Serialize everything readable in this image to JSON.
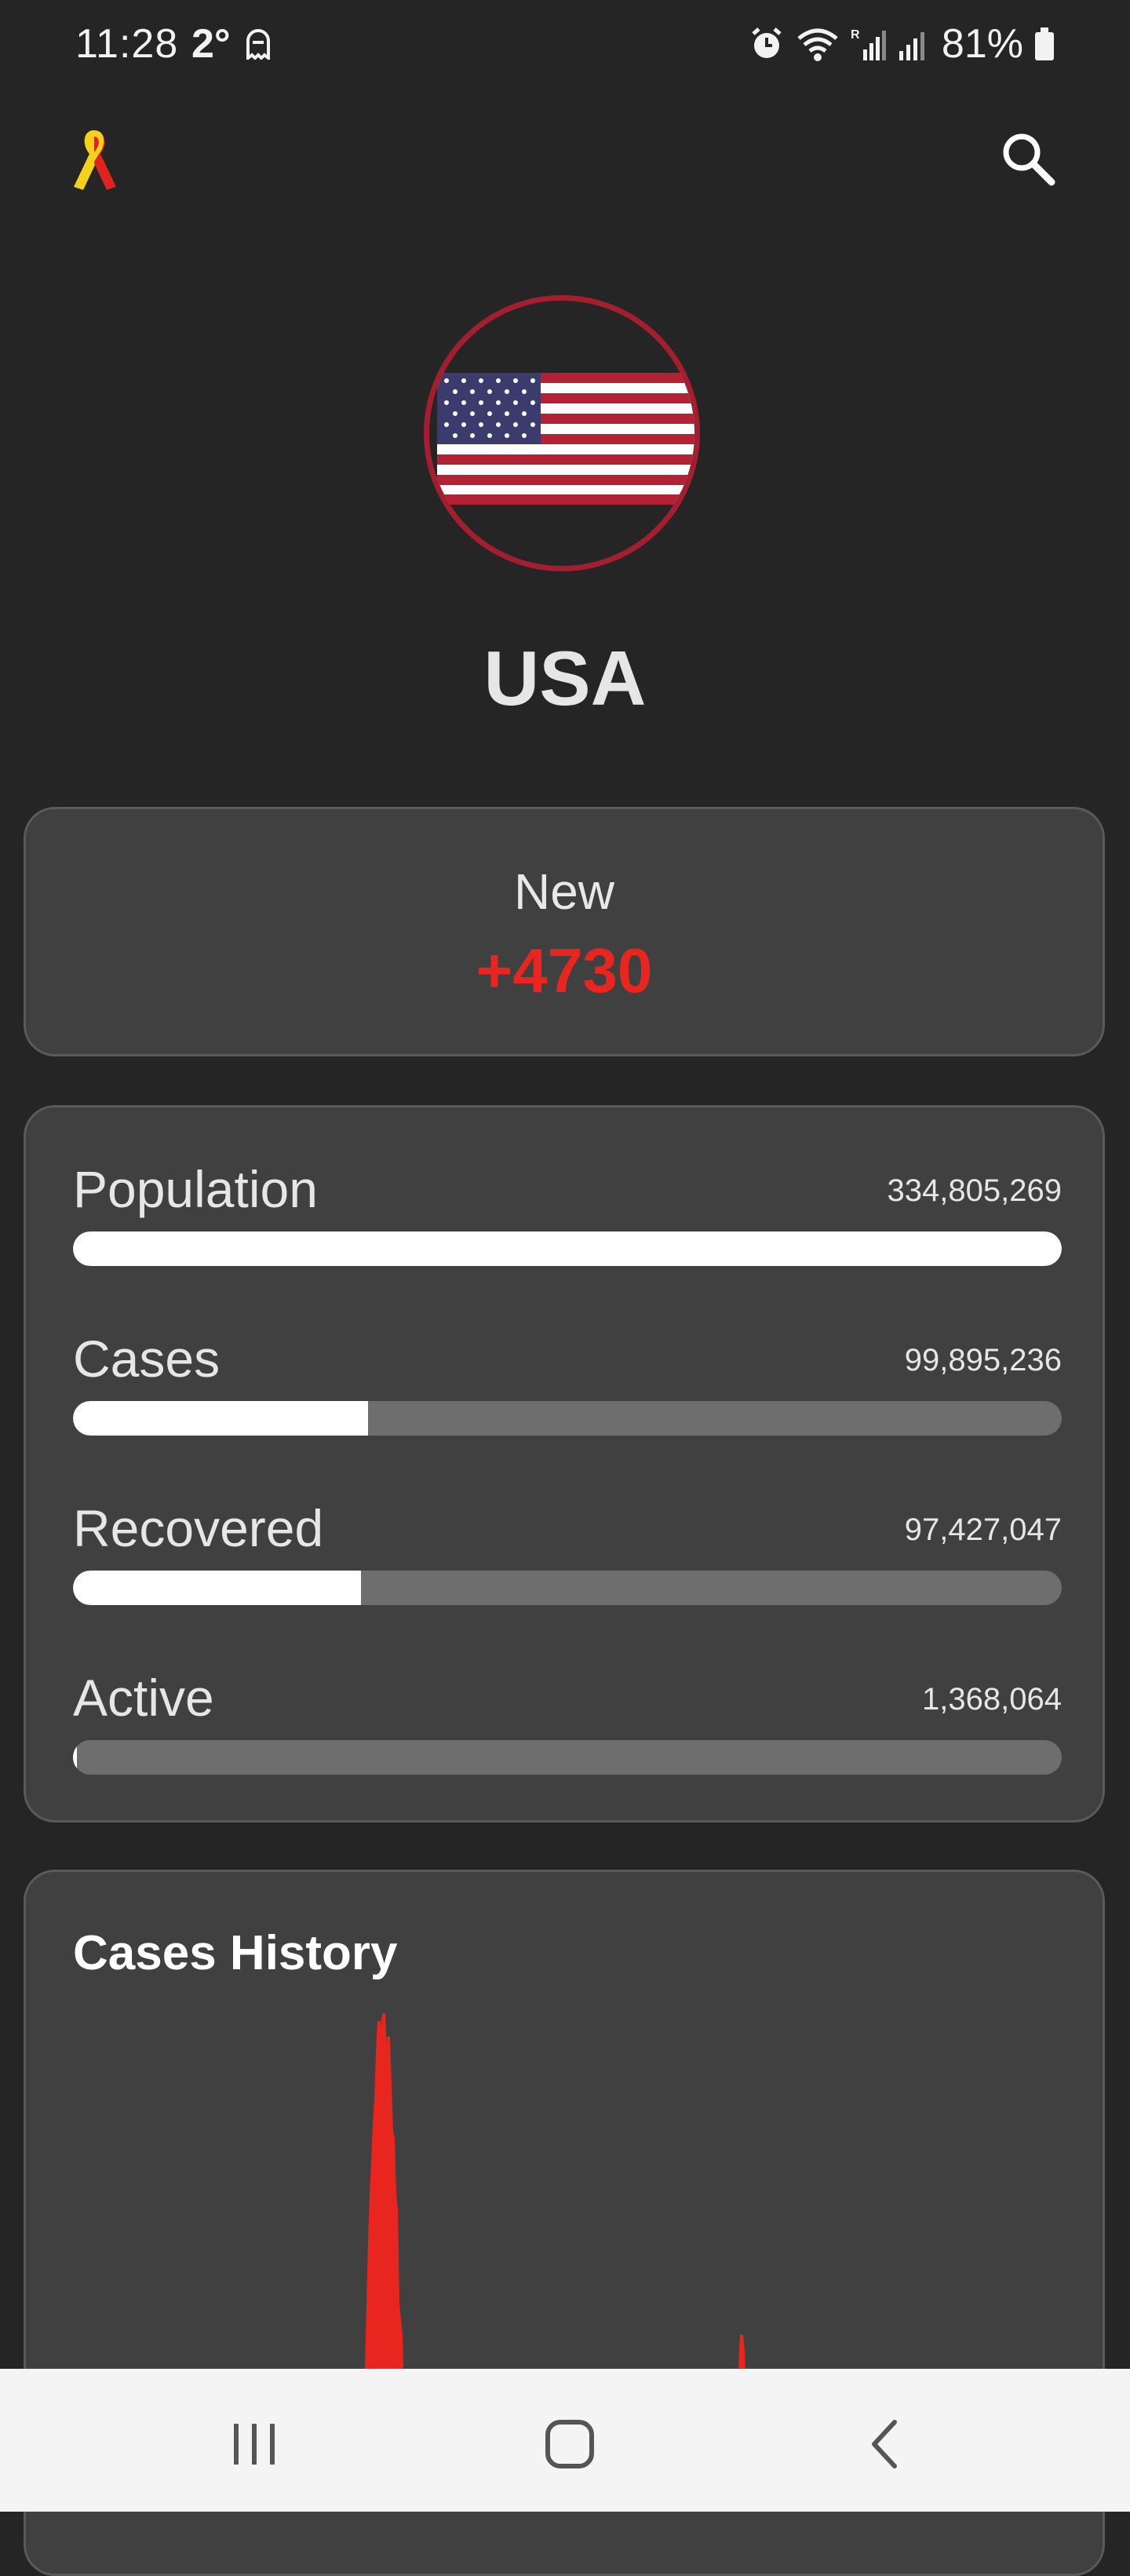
{
  "status_bar": {
    "time": "11:28",
    "temperature": "2°",
    "battery": "81%",
    "icons": [
      "ghost-icon",
      "alarm-icon",
      "wifi-icon",
      "signal-r-icon",
      "signal-icon",
      "battery-icon"
    ]
  },
  "app_bar": {
    "logo_icon": "awareness-ribbon-icon",
    "search_icon": "search-icon"
  },
  "country": {
    "name": "USA",
    "flag_icon": "us-flag-icon",
    "accent_color": "#a31e2e"
  },
  "new_cases": {
    "label": "New",
    "value": "+4730",
    "color": "#e8261f"
  },
  "stats": [
    {
      "key": "population",
      "label": "Population",
      "value": "334,805,269",
      "fraction": 1.0
    },
    {
      "key": "cases",
      "label": "Cases",
      "value": "99,895,236",
      "fraction": 0.2984
    },
    {
      "key": "recovered",
      "label": "Recovered",
      "value": "97,427,047",
      "fraction": 0.291
    },
    {
      "key": "active",
      "label": "Active",
      "value": "1,368,064",
      "fraction": 0.0041
    }
  ],
  "history": {
    "title": "Cases History",
    "line_color": "#e8261f"
  },
  "nav_bar": {
    "icons": [
      "recent-apps-icon",
      "home-icon",
      "back-icon"
    ]
  }
}
